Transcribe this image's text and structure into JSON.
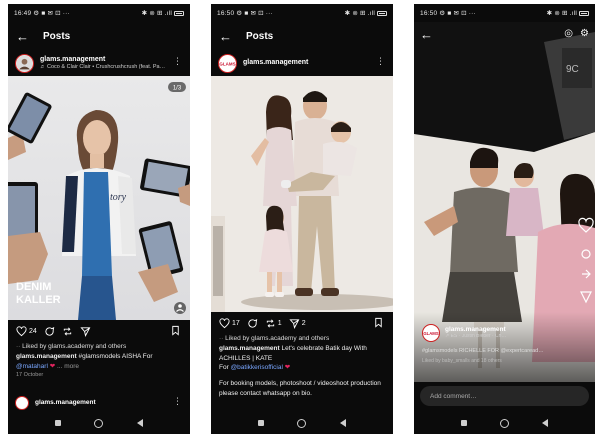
{
  "phones": [
    {
      "status": {
        "time": "16:49",
        "left_icons": "⚙ ■ ✉ ⊡ ···",
        "right_icons": "✱ ⊚ ⊞ .ıll"
      },
      "header": {
        "title": "Posts"
      },
      "post": {
        "username": "glams.management",
        "audio": "♬ Coco & Clair Clair • Crushcrushcrush (feat. Pa…",
        "photo_counter": "1/3",
        "like_count": "24",
        "liked_by": "Liked by glams.academy and others",
        "caption_user": "glams.management",
        "caption_text": "#glamsmodels AISHA For",
        "caption_mention": "@mataharl",
        "caption_more": "... more",
        "date": "17 October",
        "jacket_text": "tory",
        "brand_overlay": "DENIM\nKALLER",
        "next_username": "glams.management",
        "next_audio": "♬ …"
      }
    },
    {
      "status": {
        "time": "16:50",
        "left_icons": "⚙ ■ ✉ ⊡ ···",
        "right_icons": "✱ ⊚ ⊞ .ıll"
      },
      "header": {
        "title": "Posts"
      },
      "post": {
        "username": "glams.management",
        "like_count": "17",
        "repost_count": "1",
        "share_count": "2",
        "liked_by": "Liked by glams.academy and others",
        "caption_user": "glams.management",
        "caption_line1": "Let's celebrate Batik day With",
        "caption_line2": "ACHILLES | KATE",
        "caption_for": "For",
        "caption_mention": "@batikkerisofficial",
        "booking_text": "For booking models, photoshoot / videoshoot production please contact whatsapp on bio."
      }
    },
    {
      "status": {
        "time": "16:50",
        "left_icons": "⚙ ■ ✉ ⊡ ···",
        "right_icons": "✱ ⊚ ⊞ .ıll"
      },
      "reel": {
        "username": "glams.management",
        "audio": "↗ ES · Justin Bieber · Ch…",
        "caption": "#glamsmodels RICHELLE FOR @expertcaread…",
        "liked_by": "Liked by baby_smalls and 18 others",
        "comment_placeholder": "Add comment…"
      }
    }
  ],
  "colors": {
    "background": "#0b0b0b",
    "accent_red": "#e0245e",
    "mention": "#7aa7ff"
  }
}
